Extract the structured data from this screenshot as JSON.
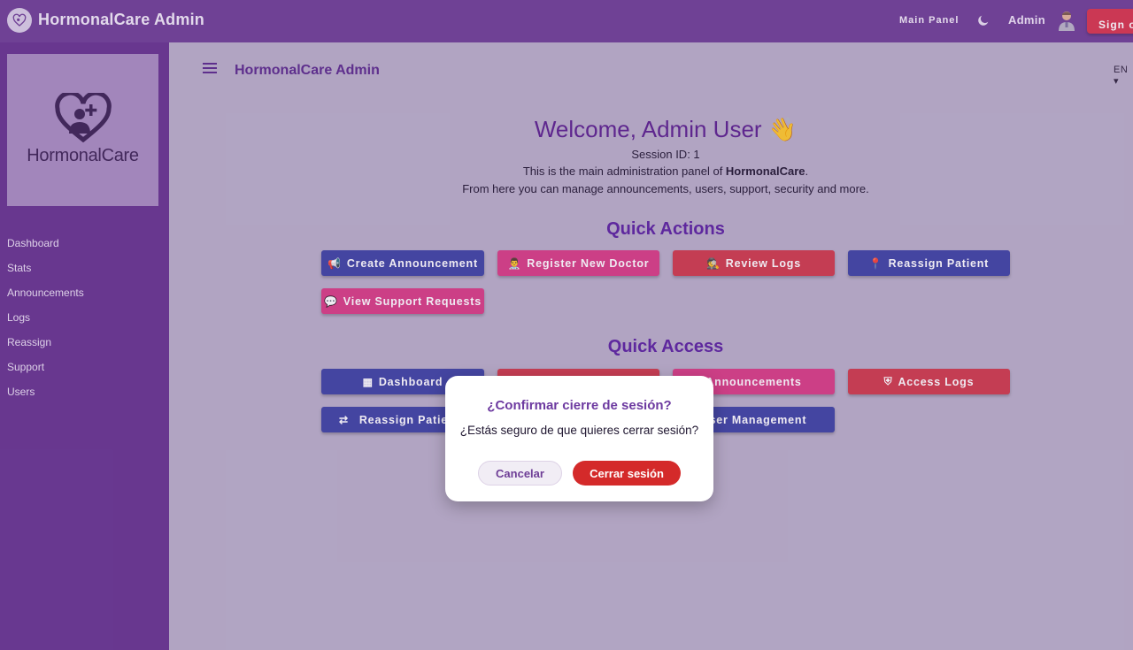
{
  "appbar": {
    "title": "HormonalCare Admin",
    "main_panel": "Main Panel",
    "theme_icon": "moon-icon",
    "admin_label": "Admin",
    "avatar_icon": "doctor-avatar-icon",
    "sign_out": "Sign out"
  },
  "sidebar": {
    "brand_name": "HormonalCare",
    "items": [
      {
        "label": "Dashboard"
      },
      {
        "label": "Stats"
      },
      {
        "label": "Announcements"
      },
      {
        "label": "Logs"
      },
      {
        "label": "Reassign"
      },
      {
        "label": "Support"
      },
      {
        "label": "Users"
      }
    ]
  },
  "header": {
    "title": "HormonalCare Admin",
    "language": "EN ▾"
  },
  "welcome": {
    "greeting": "Welcome, Admin User 👋",
    "session": "Session ID: 1",
    "line1_prefix": "This is the main administration panel of ",
    "line1_brand": "HormonalCare",
    "line1_suffix": ".",
    "line2": "From here you can manage announcements, users, support, security and more."
  },
  "quick_actions": {
    "title": "Quick Actions",
    "buttons": [
      {
        "icon": "📢",
        "label": "Create Announcement"
      },
      {
        "icon": "👨‍⚕️",
        "label": "Register New Doctor"
      },
      {
        "icon": "🕵️",
        "label": "Review Logs"
      },
      {
        "icon": "📍",
        "label": "Reassign Patient"
      },
      {
        "icon": "💬",
        "label": "View Support Requests"
      }
    ]
  },
  "quick_access": {
    "title": "Quick Access",
    "buttons": [
      {
        "icon": "▦",
        "label": "Dashboard"
      },
      {
        "icon": "",
        "label": ""
      },
      {
        "icon": "",
        "label": "Announcements"
      },
      {
        "icon": "⛨",
        "label": "Access Logs"
      },
      {
        "icon": "⇄",
        "label": "Reassign Patie"
      },
      {
        "icon": "",
        "label": "User Management"
      }
    ]
  },
  "dialog": {
    "title": "¿Confirmar cierre de sesión?",
    "message": "¿Estás seguro de que quieres cerrar sesión?",
    "cancel": "Cancelar",
    "confirm": "Cerrar sesión"
  }
}
